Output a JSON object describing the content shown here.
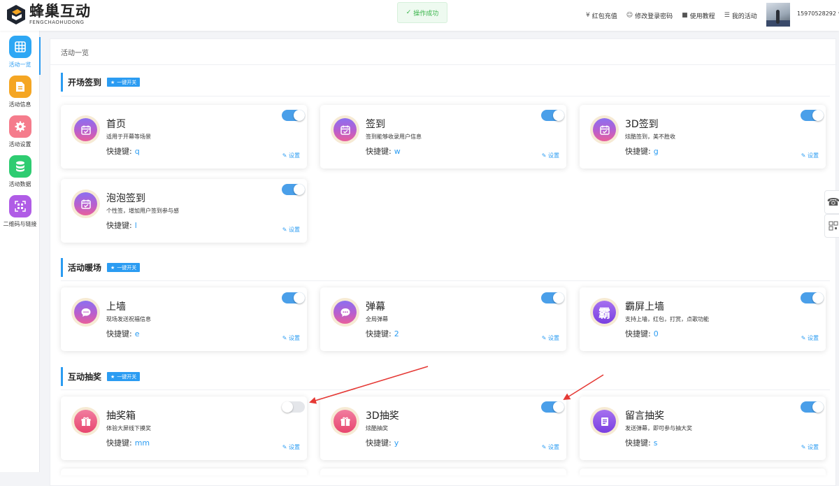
{
  "header": {
    "logo_title": "蜂巢互动",
    "logo_sub": "FENGCHAOHUDONG",
    "toast": "操作成功",
    "nav": [
      {
        "icon": "yen-icon",
        "label": "红包充值"
      },
      {
        "icon": "user-key-icon",
        "label": "修改登录密码"
      },
      {
        "icon": "document-icon",
        "label": "使用教程"
      },
      {
        "icon": "list-icon",
        "label": "我的活动"
      }
    ],
    "username": "15970528292"
  },
  "sidebar": {
    "items": [
      {
        "label": "活动一览",
        "icon": "grid-icon",
        "color": "#2ea7f4"
      },
      {
        "label": "活动信息",
        "icon": "document-icon",
        "color": "#f5a623"
      },
      {
        "label": "活动设置",
        "icon": "gear-icon",
        "color": "#f57c8c"
      },
      {
        "label": "活动数据",
        "icon": "database-icon",
        "color": "#2ecc71"
      },
      {
        "label": "二维码与链接",
        "icon": "qrcode-icon",
        "color": "#b05ce6"
      }
    ]
  },
  "breadcrumb": "活动一览",
  "common": {
    "switch_all": "一键开关",
    "hotkey_label": "快捷键:",
    "settings": "设置"
  },
  "sections": [
    {
      "title": "开场签到",
      "cards": [
        {
          "name": "首页",
          "desc": "适用于开幕等场景",
          "hotkey": "q",
          "enabled": true,
          "icon": "calendar-check-icon"
        },
        {
          "name": "签到",
          "desc": "签到能够收录用户信息",
          "hotkey": "w",
          "enabled": true,
          "icon": "calendar-check-icon"
        },
        {
          "name": "3D签到",
          "desc": "炫酷签到，美不胜收",
          "hotkey": "g",
          "enabled": true,
          "icon": "calendar-check-icon"
        },
        {
          "name": "泡泡签到",
          "desc": "个性签，增加用户签到参与感",
          "hotkey": "l",
          "enabled": true,
          "icon": "calendar-check-icon"
        }
      ]
    },
    {
      "title": "活动暖场",
      "cards": [
        {
          "name": "上墙",
          "desc": "现场发送祝福信息",
          "hotkey": "e",
          "enabled": true,
          "icon": "chat-bubble-icon"
        },
        {
          "name": "弹幕",
          "desc": "全局弹幕",
          "hotkey": "2",
          "enabled": true,
          "icon": "chat-bubble-icon"
        },
        {
          "name": "霸屏上墙",
          "desc": "支持上墙，红包，打赏，点歌功能",
          "hotkey": "0",
          "enabled": true,
          "icon": "ba-char-icon",
          "icon_text": "霸"
        }
      ]
    },
    {
      "title": "互动抽奖",
      "cards": [
        {
          "name": "抽奖箱",
          "desc": "体验大屏线下摸奖",
          "hotkey": "mm",
          "enabled": false,
          "icon": "gift-icon"
        },
        {
          "name": "3D抽奖",
          "desc": "炫酷抽奖",
          "hotkey": "y",
          "enabled": true,
          "icon": "gift-icon"
        },
        {
          "name": "留言抽奖",
          "desc": "发送弹幕，即可参与抽大奖",
          "hotkey": "s",
          "enabled": true,
          "icon": "note-icon"
        }
      ]
    }
  ],
  "float_buttons": [
    "phone-icon",
    "qrcode-icon"
  ],
  "colors": {
    "accent": "#2b9cf2",
    "arrow": "#e53935"
  }
}
